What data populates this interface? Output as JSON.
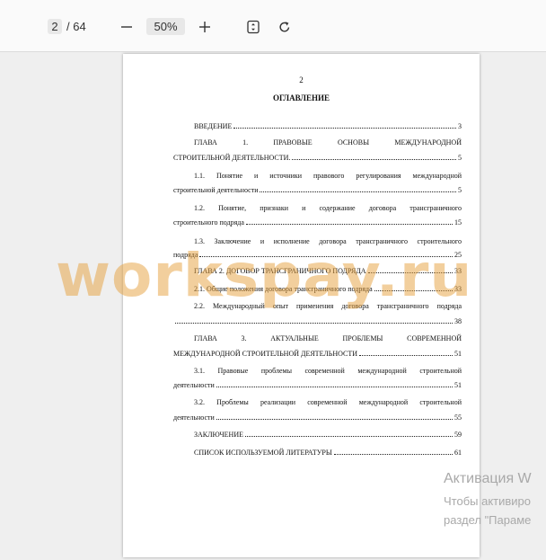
{
  "toolbar": {
    "current_page": "2",
    "page_total": "/ 64",
    "zoom_out_icon": "minus-icon",
    "zoom_level": "50%",
    "zoom_in_icon": "plus-icon",
    "fit_icon": "fit-page-icon",
    "rotate_icon": "rotate-icon"
  },
  "document": {
    "page_number": "2",
    "title": "ОГЛАВЛЕНИЕ",
    "toc": {
      "intro": {
        "label": "ВВЕДЕНИЕ",
        "page": "3"
      },
      "ch1_line1": "ГЛАВА 1. ПРАВОВЫЕ ОСНОВЫ МЕЖДУНАРОДНОЙ",
      "ch1_line2": "СТРОИТЕЛЬНОЙ ДЕЯТЕЛЬНОСТИ.",
      "ch1_page": "5",
      "s11_line1": "1.1. Понятие и источники правового регулирования  международной",
      "s11_line2": "строительной деятельности",
      "s11_page": "5",
      "s12_line1": "1.2. Понятие, признаки и содержание  договора трансграничного",
      "s12_line2": "строительного подряда",
      "s12_page": "15",
      "s13_line1": "1.3. Заключение и исполнение  договора трансграничного строительного",
      "s13_line2": "подряда",
      "s13_page": "25",
      "ch2": {
        "label": "ГЛАВА 2. ДОГОВОР ТРАНСГРАНИЧНОГО ПОДРЯДА",
        "page": "33"
      },
      "s21": {
        "label": "2.1. Общие положения договора трансграничного подряда",
        "page": "33"
      },
      "s22_line1": "2.2. Международный опыт применения договора трансграничного подряда",
      "s22_page": "38",
      "ch3_line1": "ГЛАВА 3. АКТУАЛЬНЫЕ ПРОБЛЕМЫ СОВРЕМЕННОЙ",
      "ch3_line2": "МЕЖДУНАРОДНОЙ СТРОИТЕЛЬНОЙ ДЕЯТЕЛЬНОСТИ",
      "ch3_page": "51",
      "s31_line1": "3.1. Правовые проблемы современной международной строительной",
      "s31_line2": "деятельности",
      "s31_page": "51",
      "s32_line1": "3.2. Проблемы реализации современной международной строительной",
      "s32_line2": "деятельности",
      "s32_page": "55",
      "conclusion": {
        "label": "ЗАКЛЮЧЕНИЕ",
        "page": "59"
      },
      "literature": {
        "label": "СПИСОК ИСПОЛЬЗУЕМОЙ ЛИТЕРАТУРЫ",
        "page": "61"
      }
    }
  },
  "watermark": "workspay.ru",
  "activation": {
    "title": "Активация W",
    "line1": "Чтобы активиро",
    "line2": "раздел \"Параме"
  }
}
